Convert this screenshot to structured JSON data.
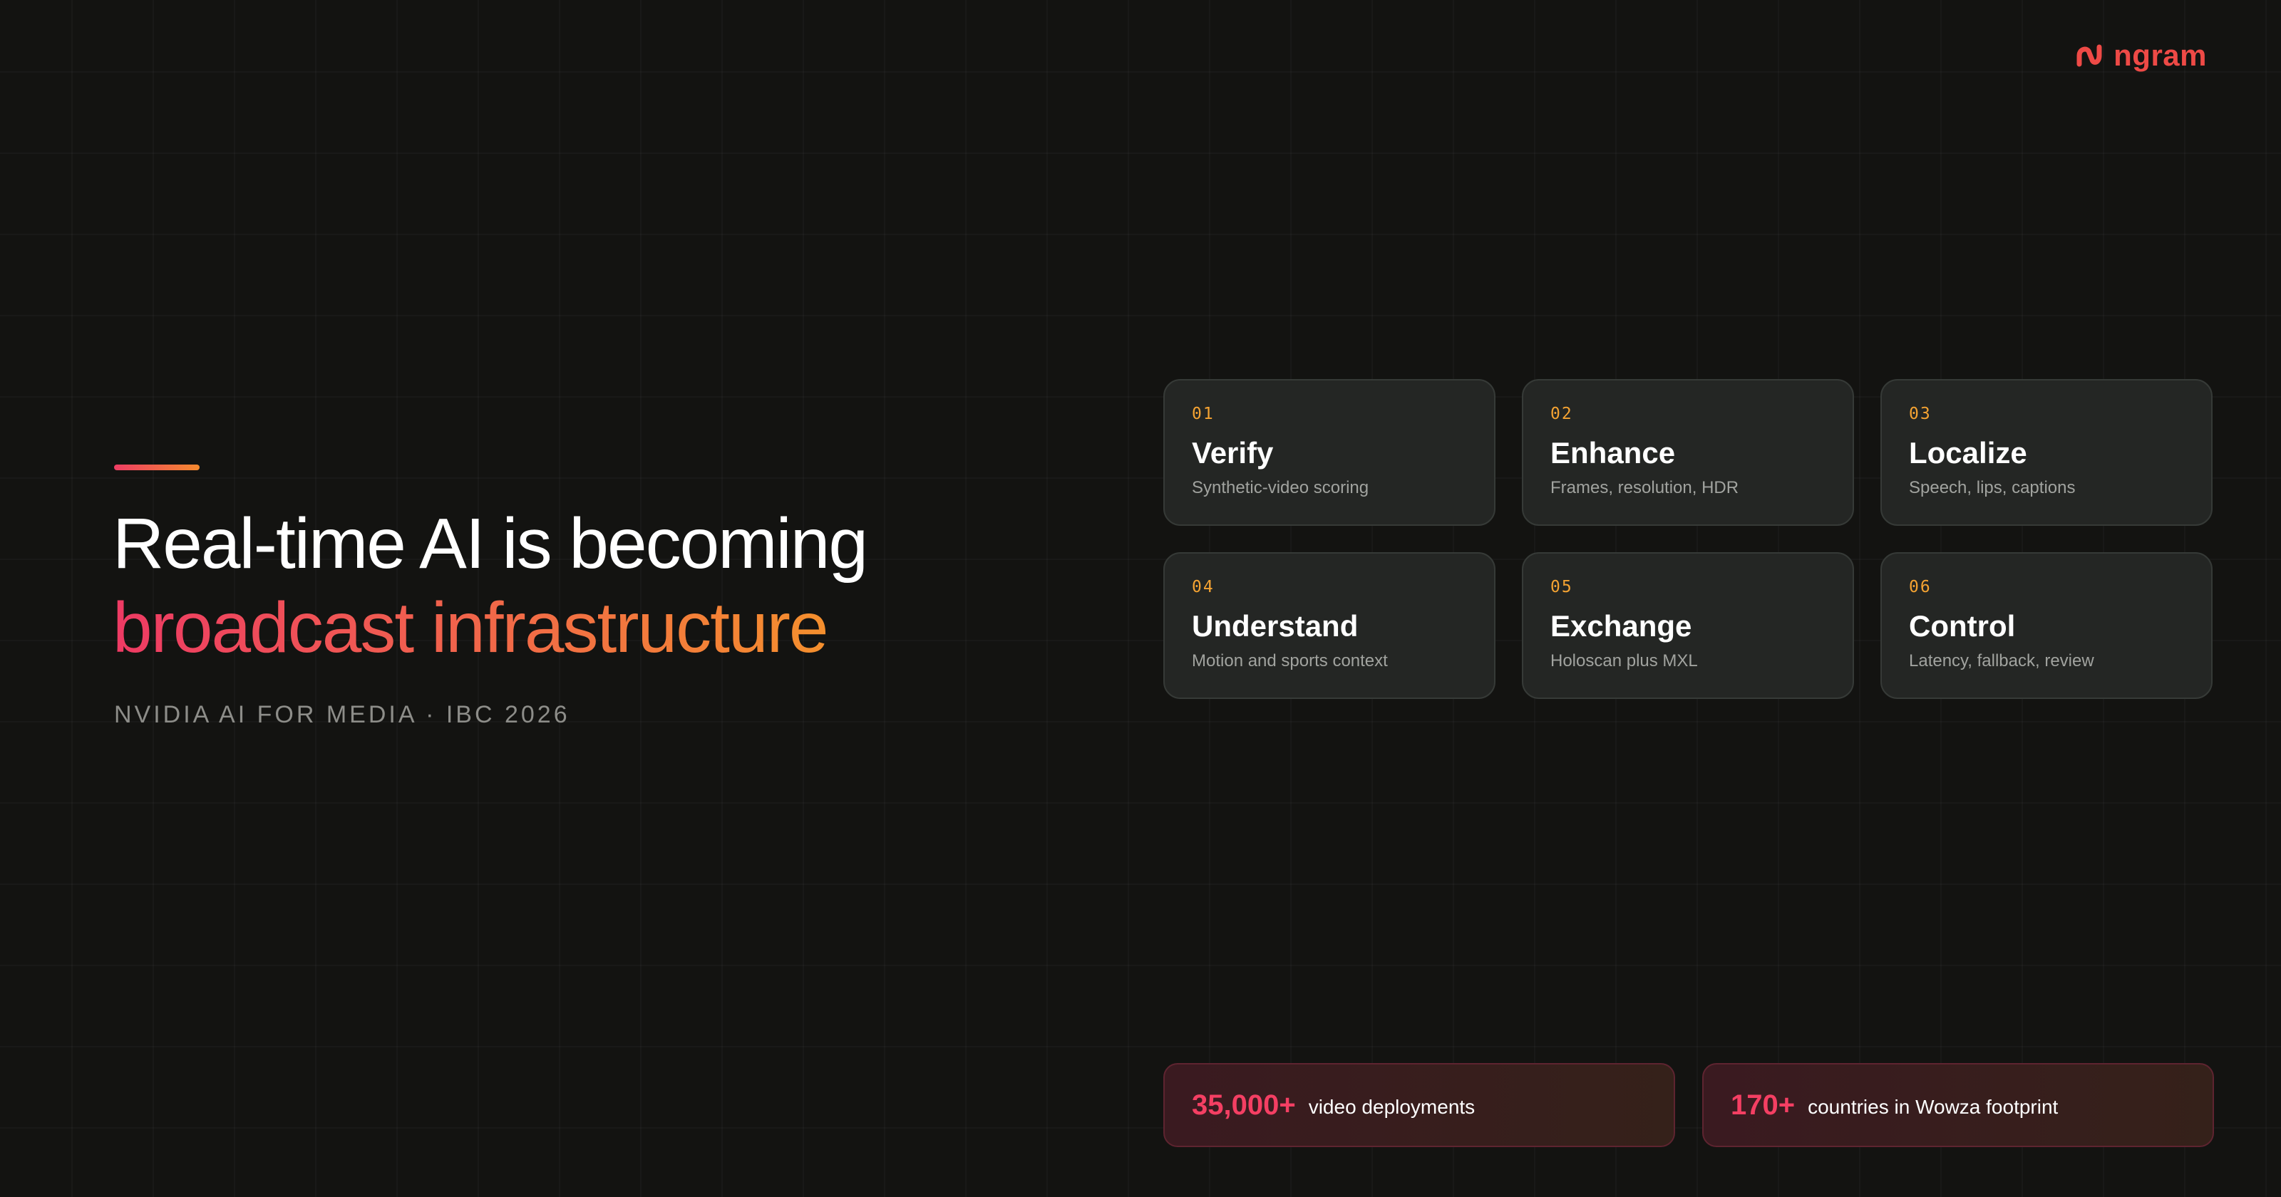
{
  "brand": {
    "name": "ngram",
    "color": "#ee4a46",
    "icon": "ngram-logo-icon"
  },
  "hero": {
    "headline_line1": "Real-time AI is becoming",
    "headline_line2": "broadcast infrastructure",
    "eyebrow": "NVIDIA AI FOR MEDIA · IBC 2026",
    "gradient_start": "#ee3a64",
    "gradient_end": "#f5942a"
  },
  "cards": [
    {
      "num": "01",
      "title": "Verify",
      "subtitle": "Synthetic-video scoring"
    },
    {
      "num": "02",
      "title": "Enhance",
      "subtitle": "Frames, resolution, HDR"
    },
    {
      "num": "03",
      "title": "Localize",
      "subtitle": "Speech, lips, captions"
    },
    {
      "num": "04",
      "title": "Understand",
      "subtitle": "Motion and sports context"
    },
    {
      "num": "05",
      "title": "Exchange",
      "subtitle": "Holoscan plus MXL"
    },
    {
      "num": "06",
      "title": "Control",
      "subtitle": "Latency, fallback, review"
    }
  ],
  "stats": [
    {
      "value": "35,000+",
      "label": "video deployments"
    },
    {
      "value": "170+",
      "label": "countries in Wowza footprint"
    }
  ],
  "colors": {
    "background": "#131311",
    "card_bg": "#242624",
    "card_number": "#f5a332",
    "stat_value": "#f43f63"
  }
}
